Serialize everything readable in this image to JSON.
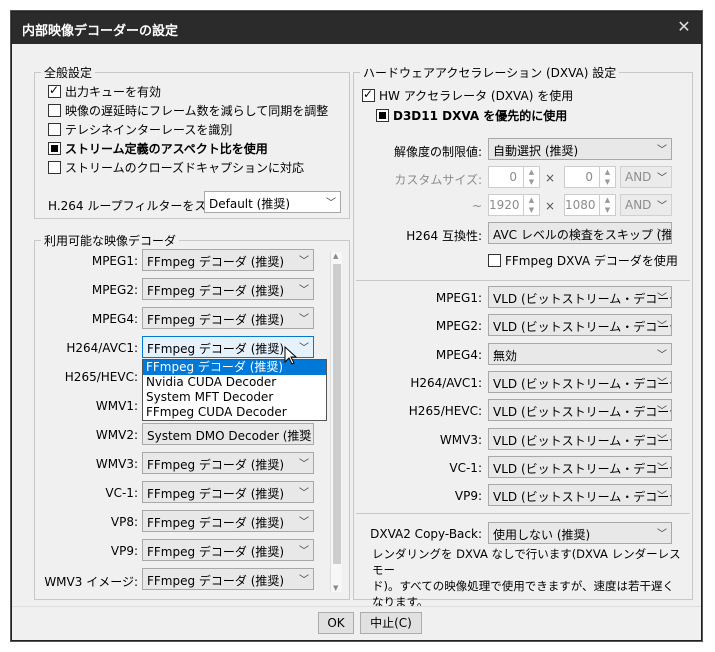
{
  "window": {
    "title": "内部映像デコーダーの設定",
    "close_icon": "close-icon"
  },
  "general": {
    "legend": "全般設定",
    "items": [
      {
        "label": "出力キューを有効",
        "state": "checked",
        "bold": false
      },
      {
        "label": "映像の遅延時にフレーム数を減らして同期を調整",
        "state": "unchecked",
        "bold": false
      },
      {
        "label": "テレシネインターレースを識別",
        "state": "unchecked",
        "bold": false
      },
      {
        "label": "ストリーム定義のアスペクト比を使用",
        "state": "indeterminate",
        "bold": true
      },
      {
        "label": "ストリームのクローズドキャプションに対応",
        "state": "unchecked",
        "bold": false
      }
    ],
    "loopfilter_label": "H.264 ループフィルターをスキッ",
    "loopfilter_value": "Default (推奨)"
  },
  "decoders": {
    "legend": "利用可能な映像デコーダ",
    "rows": [
      {
        "label": "MPEG1:",
        "value": "FFmpeg デコーダ (推奨)"
      },
      {
        "label": "MPEG2:",
        "value": "FFmpeg デコーダ (推奨)"
      },
      {
        "label": "MPEG4:",
        "value": "FFmpeg デコーダ (推奨)"
      },
      {
        "label": "H264/AVC1:",
        "value": "FFmpeg デコーダ (推奨)"
      },
      {
        "label": "H265/HEVC:",
        "value": ""
      },
      {
        "label": "WMV1:",
        "value": ""
      },
      {
        "label": "WMV2:",
        "value": "System DMO Decoder (推奨"
      },
      {
        "label": "WMV3:",
        "value": "FFmpeg デコーダ (推奨)"
      },
      {
        "label": "VC-1:",
        "value": "FFmpeg デコーダ (推奨)"
      },
      {
        "label": "VP8:",
        "value": "FFmpeg デコーダ (推奨)"
      },
      {
        "label": "VP9:",
        "value": "FFmpeg デコーダ (推奨)"
      },
      {
        "label": "WMV3 イメージ:",
        "value": "FFmpeg デコーダ (推奨)"
      }
    ],
    "dropdown_options": [
      "FFmpeg デコーダ (推奨)",
      "Nvidia CUDA Decoder",
      "System MFT Decoder",
      "FFmpeg CUDA Decoder"
    ],
    "dropdown_selected": 0
  },
  "hw": {
    "legend": "ハードウェアアクセラレーション (DXVA) 設定",
    "hw_accel_label": "HW アクセラレータ (DXVA) を使用",
    "d3d11_label": "D3D11 DXVA を優先的に使用",
    "resolution_label": "解像度の制限値:",
    "resolution_value": "自動選択 (推奨)",
    "custom_size_label": "カスタムサイズ:",
    "min_w": "0",
    "min_h": "0",
    "and1": "AND",
    "tilde": "~",
    "max_w": "1920",
    "max_h": "1080",
    "and2": "AND",
    "times": "×",
    "h264compat_label": "H264 互換性:",
    "h264compat_value": "AVC レベルの検査をスキップ (推",
    "ffmpeg_dxva_label": "FFmpeg DXVA デコーダを使用",
    "rows": [
      {
        "label": "MPEG1:",
        "value": "VLD (ビットストリーム・デコーディ"
      },
      {
        "label": "MPEG2:",
        "value": "VLD (ビットストリーム・デコーディ"
      },
      {
        "label": "MPEG4:",
        "value": "無効"
      },
      {
        "label": "H264/AVC1:",
        "value": "VLD (ビットストリーム・デコーディ"
      },
      {
        "label": "H265/HEVC:",
        "value": "VLD (ビットストリーム・デコーディ"
      },
      {
        "label": "WMV3:",
        "value": "VLD (ビットストリーム・デコーディ"
      },
      {
        "label": "VC-1:",
        "value": "VLD (ビットストリーム・デコーディ"
      },
      {
        "label": "VP9:",
        "value": "VLD (ビットストリーム・デコーディ"
      }
    ],
    "copyback_label": "DXVA2 Copy-Back:",
    "copyback_value": "使用しない (推奨)",
    "note_lines": [
      "レンダリングを DXVA なしで行います(DXVA レンダーレスモー",
      "ド)。すべての映像処理で使用できますが、速度は若干遅く",
      "なります。"
    ]
  },
  "buttons": {
    "ok": "OK",
    "cancel": "中止(C)"
  }
}
